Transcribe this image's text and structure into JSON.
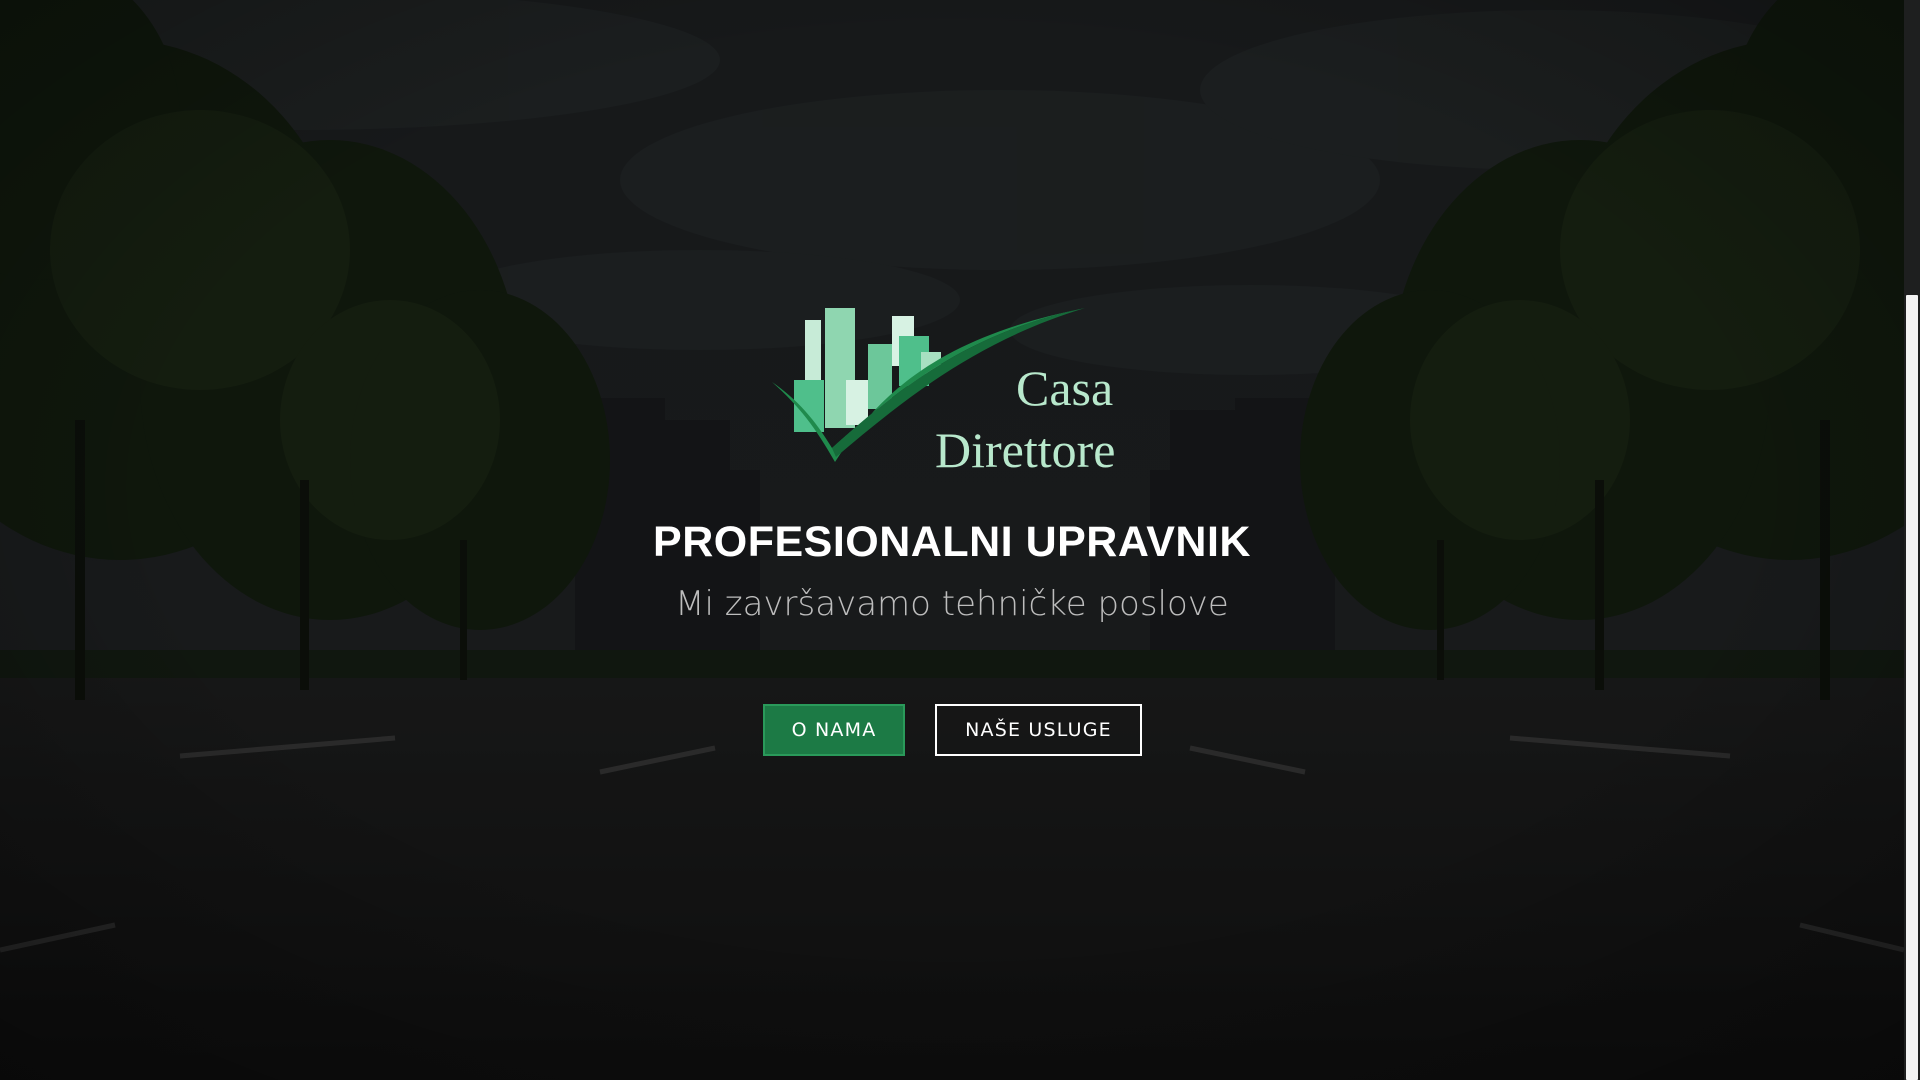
{
  "brand": {
    "name_line1": "Casa",
    "name_line2": "Direttore",
    "logo_icon": "buildings-checkmark-logo",
    "colors": {
      "brand_green": "#1c7a45",
      "logo_light": "#b8e8cc",
      "logo_mid": "#6cc79a",
      "logo_dark": "#1f8a4c"
    }
  },
  "hero": {
    "title": "PROFESIONALNI UPRAVNIK",
    "subtitle": "Mi završavamo tehničke poslove",
    "background": "city-road-with-trees-photo"
  },
  "buttons": {
    "about_label": "O NAMA",
    "services_label": "NAŠE USLUGE"
  }
}
